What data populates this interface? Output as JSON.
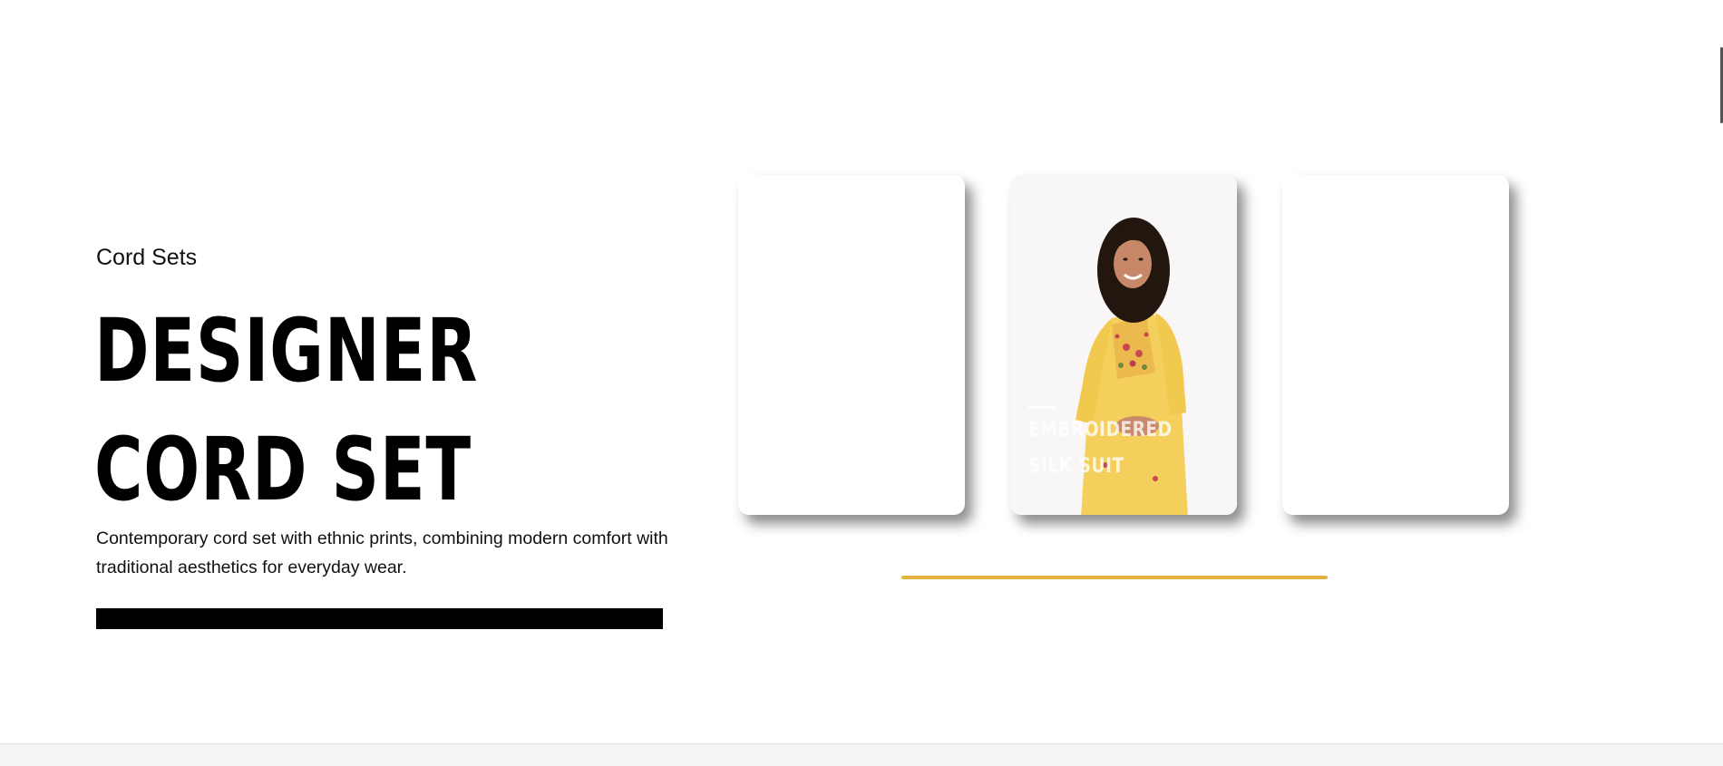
{
  "hero": {
    "category": "Cord Sets",
    "headline_line1": "DESIGNER",
    "headline_line2": "CORD SET",
    "description": "Contemporary cord set with ethnic prints, combining modern comfort with traditional aesthetics for everyday wear."
  },
  "carousel": {
    "active_card": {
      "label_line1": "EMBROIDERED",
      "label_line2": "SILK SUIT"
    },
    "progress_color": "#e3b13d"
  },
  "icons": {
    "model": "model-photo-yellow-embroidered-kurta"
  }
}
